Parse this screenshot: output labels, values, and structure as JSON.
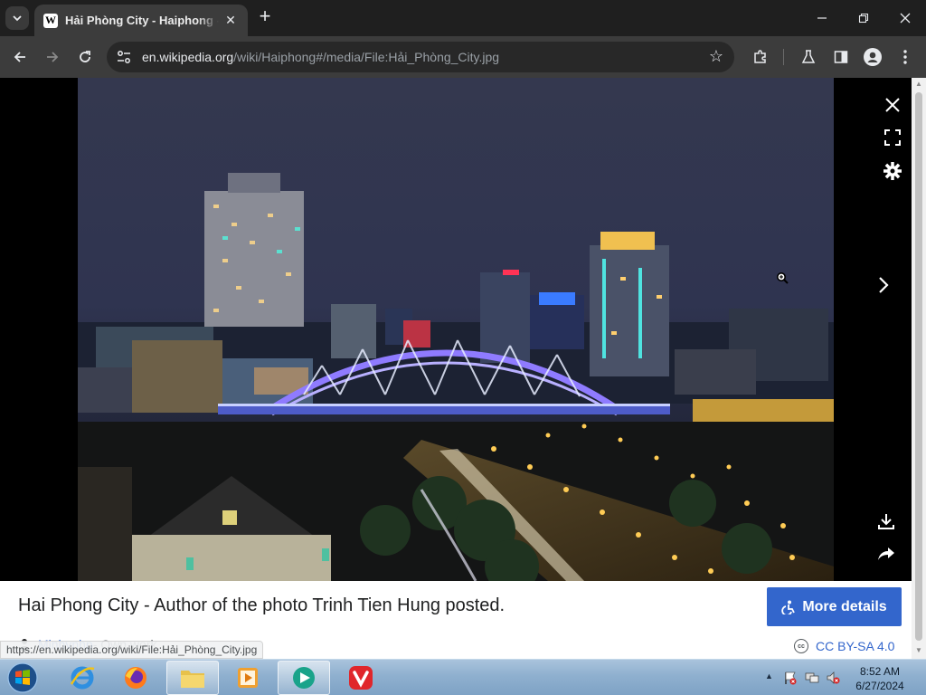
{
  "browser": {
    "tab": {
      "title": "Hải Phòng City - Haiphong - Wikipedia"
    },
    "address_bar": {
      "host": "en.wikipedia.org",
      "path": "/wiki/Haiphong#/media/File:Hải_Phòng_City.jpg"
    },
    "status_url": "https://en.wikipedia.org/wiki/File:Hải_Phòng_City.jpg"
  },
  "media_viewer": {
    "caption": "Hai Phong City - Author of the photo Trinh Tien Hung posted.",
    "more_details_label": "More details",
    "author_name": "Minhvnhp",
    "author_suffix": " - Own work",
    "license_label": "CC BY-SA 4.0"
  },
  "taskbar": {
    "time": "8:52 AM",
    "date": "6/27/2024"
  },
  "colors": {
    "accent_blue": "#3366cc",
    "browser_dark": "#3c3c3c",
    "taskbar_blue": "#8fb0cf"
  }
}
